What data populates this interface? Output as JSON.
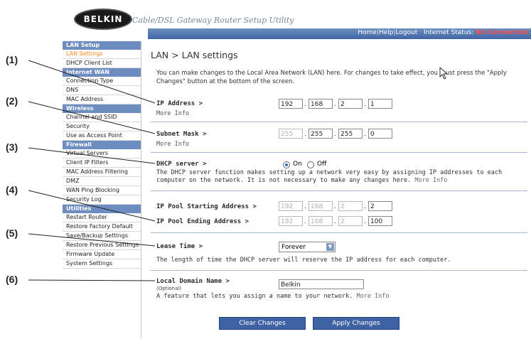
{
  "header": {
    "logo": "BELKIN",
    "tagline": "Cable/DSL Gateway Router Setup Utility",
    "links": [
      "Home",
      "Help",
      "Logout"
    ],
    "status_label": "Internet Status:",
    "status_value": "No Connection",
    "status_color": "#ff4a4a"
  },
  "sidebar": {
    "sections": [
      {
        "title": "LAN Setup",
        "items": [
          "LAN Settings",
          "DHCP Client List"
        ]
      },
      {
        "title": "Internet WAN",
        "items": [
          "Connection Type",
          "DNS",
          "MAC Address"
        ]
      },
      {
        "title": "Wireless",
        "items": [
          "Channel and SSID",
          "Security",
          "Use as Access Point"
        ]
      },
      {
        "title": "Firewall",
        "items": [
          "Virtual Servers",
          "Client IP Filters",
          "MAC Address Filtering",
          "DMZ",
          "WAN Ping Blocking",
          "Security Log"
        ]
      },
      {
        "title": "Utilities",
        "items": [
          "Restart Router",
          "Restore Factory Default",
          "Save/Backup Settings",
          "Restore Previous Settings",
          "Firmware Update",
          "System Settings"
        ]
      }
    ],
    "active_item": "LAN Settings"
  },
  "page": {
    "title": "LAN > LAN settings",
    "intro": "You can make changes to the Local Area Network (LAN) here. For changes to take effect, you must press the \"Apply Changes\" button at the bottom of the screen.",
    "ip_address": {
      "label": "IP Address >",
      "more": "More Info",
      "octets": [
        "192",
        "168",
        "2",
        "1"
      ]
    },
    "subnet_mask": {
      "label": "Subnet Mask >",
      "more": "More Info",
      "octets": [
        "255",
        "255",
        "255",
        "0"
      ]
    },
    "dhcp": {
      "label": "DHCP server >",
      "on_label": "On",
      "off_label": "Off",
      "selected": "On",
      "desc": "The DHCP server function makes setting up a network very easy by assigning IP addresses to each computer on the network. It is not necessary to make any changes here.",
      "more": "More Info"
    },
    "pool_start": {
      "label": "IP Pool Starting Address >",
      "octets": [
        "192",
        "168",
        "2",
        "2"
      ]
    },
    "pool_end": {
      "label": "IP Pool Ending Address >",
      "octets": [
        "192",
        "168",
        "2",
        "100"
      ]
    },
    "lease": {
      "label": "Lease Time >",
      "value": "Forever",
      "desc": "The length of time the DHCP server will reserve the IP address for each computer."
    },
    "domain": {
      "label": "Local Domain Name >",
      "optional": "(Optional)",
      "value": "Belkin",
      "desc": "A feature that lets you assign a name to your network.",
      "more": "More Info"
    },
    "buttons": {
      "clear": "Clear Changes",
      "apply": "Apply Changes"
    }
  },
  "callouts": [
    "(1)",
    "(2)",
    "(3)",
    "(4)",
    "(5)",
    "(6)"
  ]
}
